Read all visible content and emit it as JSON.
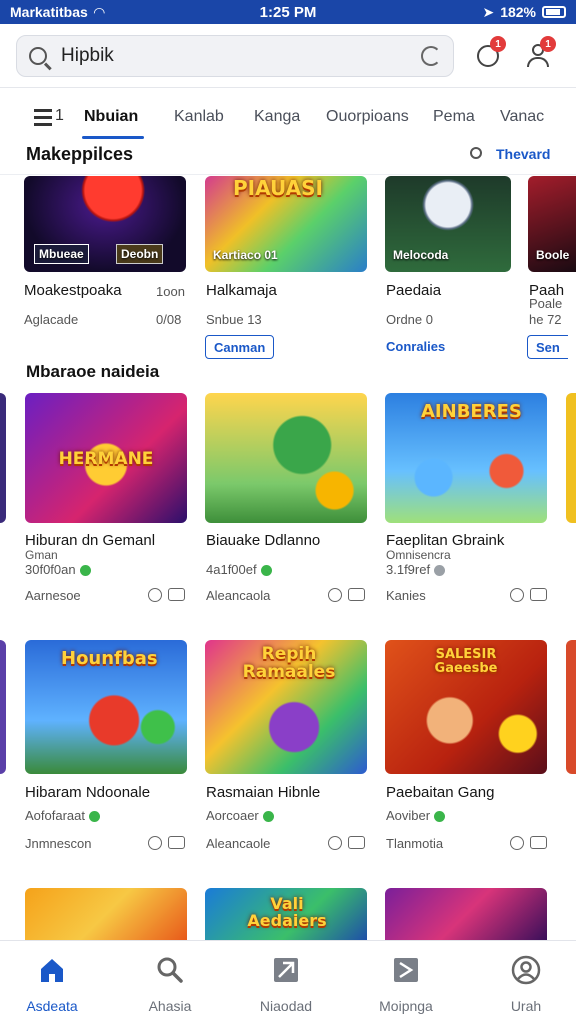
{
  "status_bar": {
    "carrier": "Markatitbas",
    "time": "1:25 PM",
    "battery": "182%"
  },
  "search": {
    "value": "Hipbik",
    "notifications": [
      "1",
      "1"
    ]
  },
  "tabs": {
    "menu_count": "1",
    "items": [
      "Nbuian",
      "Kanlab",
      "Kanga",
      "Ouorpioans",
      "Pema",
      "Vanac"
    ],
    "active": "Nbuian"
  },
  "marketplace": {
    "title": "Makeppilces",
    "link": "Thevard",
    "cards": [
      {
        "thumb_label_a": "Mbueae",
        "thumb_label_b": "Deobn",
        "title": "Moakestpoaka",
        "side": "1oon",
        "sub": "Aglacade",
        "meta": "0/08"
      },
      {
        "thumb_label_a": "Kartiaco 01",
        "banner": "PIAUASI",
        "title": "Halkamaja",
        "sub": "Snbue 13",
        "button": "Canman"
      },
      {
        "thumb_label_a": "Melocoda",
        "title": "Paedaia",
        "sub": "Ordne 0",
        "link": "Conralies"
      },
      {
        "thumb_label_a": "Boole",
        "title": "Paah",
        "title2": "Poale",
        "sub": "he 72",
        "button": "Sen"
      }
    ]
  },
  "section2": {
    "title": "Mbaraoe naideia"
  },
  "grid_row1": [
    {
      "banner": "HERMANE",
      "title": "Hiburan dn Gemanl",
      "line2": "Gman",
      "meta": "30f0f0an",
      "badge": "green",
      "foot": "Aarnesoe"
    },
    {
      "banner": "",
      "title": "Biauake Ddlanno",
      "meta": "4a1f00ef",
      "badge": "green",
      "foot": "Aleancaola"
    },
    {
      "banner": "AINBERES",
      "title": "Faeplitan Gbraink",
      "line2": "Omnisencra",
      "meta": "3.1f9ref",
      "badge": "grey",
      "foot": "Kanies"
    }
  ],
  "grid_row2": [
    {
      "banner": "Hounfbas",
      "title": "Hibaram Ndoonale",
      "meta": "Aofofaraat",
      "badge": "green",
      "foot": "Jnmnescon"
    },
    {
      "banner": "Repih Ramaales",
      "title": "Rasmaian Hibnle",
      "meta": "Aorcoaer",
      "badge": "green",
      "foot": "Aleancaole"
    },
    {
      "banner": "SALESIR Gaeesbe",
      "title": "Paebaitan Gang",
      "meta": "Aoviber",
      "badge": "green",
      "foot": "Tlanmotia"
    }
  ],
  "grid_row3": [
    {
      "banner": ""
    },
    {
      "banner": "Vali Aedaiers"
    },
    {
      "banner": ""
    }
  ],
  "bottom_nav": [
    {
      "label": "Asdeata",
      "icon": "home-icon",
      "active": true
    },
    {
      "label": "Ahasia",
      "icon": "search-icon",
      "active": false
    },
    {
      "label": "Niaodad",
      "icon": "gallery-icon",
      "active": false
    },
    {
      "label": "Moipnga",
      "icon": "flag-icon",
      "active": false
    },
    {
      "label": "Urah",
      "icon": "profile-icon",
      "active": false
    }
  ],
  "colors": {
    "accent": "#1a58c8",
    "status_bar": "#1a46a8",
    "verified": "#3ab54a"
  }
}
